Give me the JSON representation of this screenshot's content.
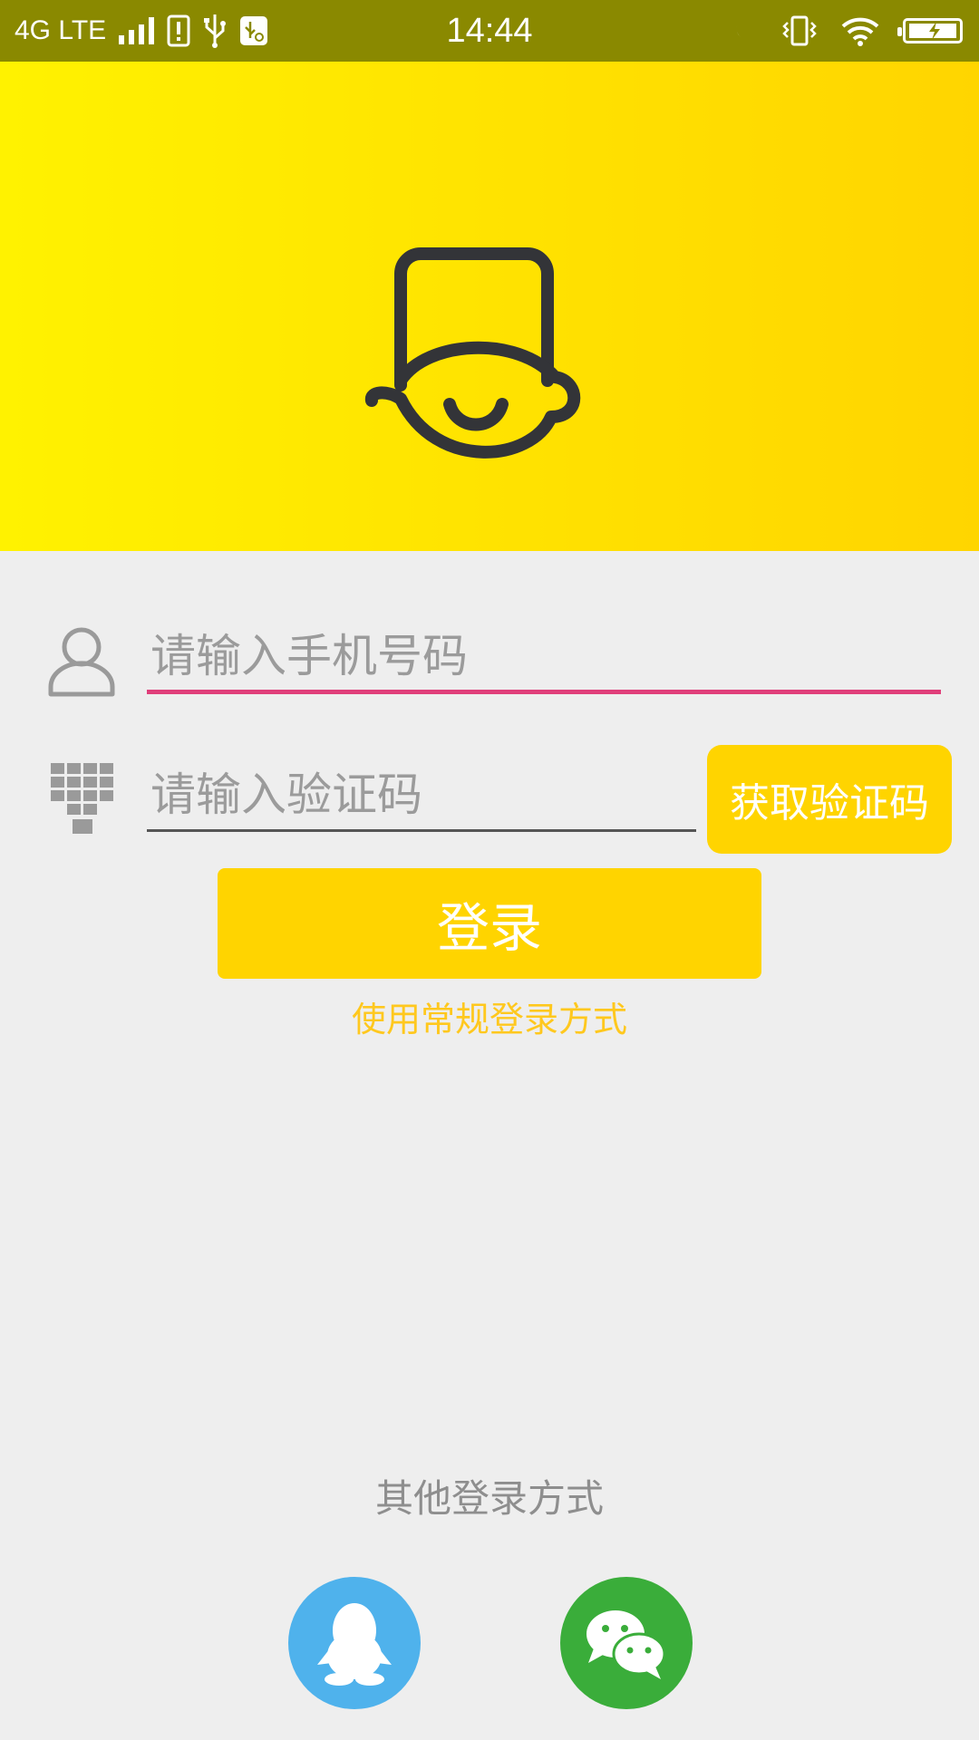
{
  "status_bar": {
    "network": "4G LTE",
    "time": "14:44"
  },
  "banner": {
    "bg_color": "#ffe500",
    "logo_icon": "smiling-chef-face-icon"
  },
  "form": {
    "phone_placeholder": "请输入手机号码",
    "code_placeholder": "请输入验证码",
    "get_code_label": "获取验证码",
    "login_label": "登录",
    "alt_login_link": "使用常规登录方式"
  },
  "other_login": {
    "label": "其他登录方式",
    "providers": [
      {
        "name": "QQ",
        "icon": "qq-penguin-icon",
        "color": "#4fb2ec"
      },
      {
        "name": "WeChat",
        "icon": "wechat-icon",
        "color": "#3aad3a"
      }
    ]
  },
  "colors": {
    "accent": "#ffd400",
    "status_bar": "#8a8900",
    "focused_underline": "#e03e7a",
    "link": "#ffc81e"
  }
}
